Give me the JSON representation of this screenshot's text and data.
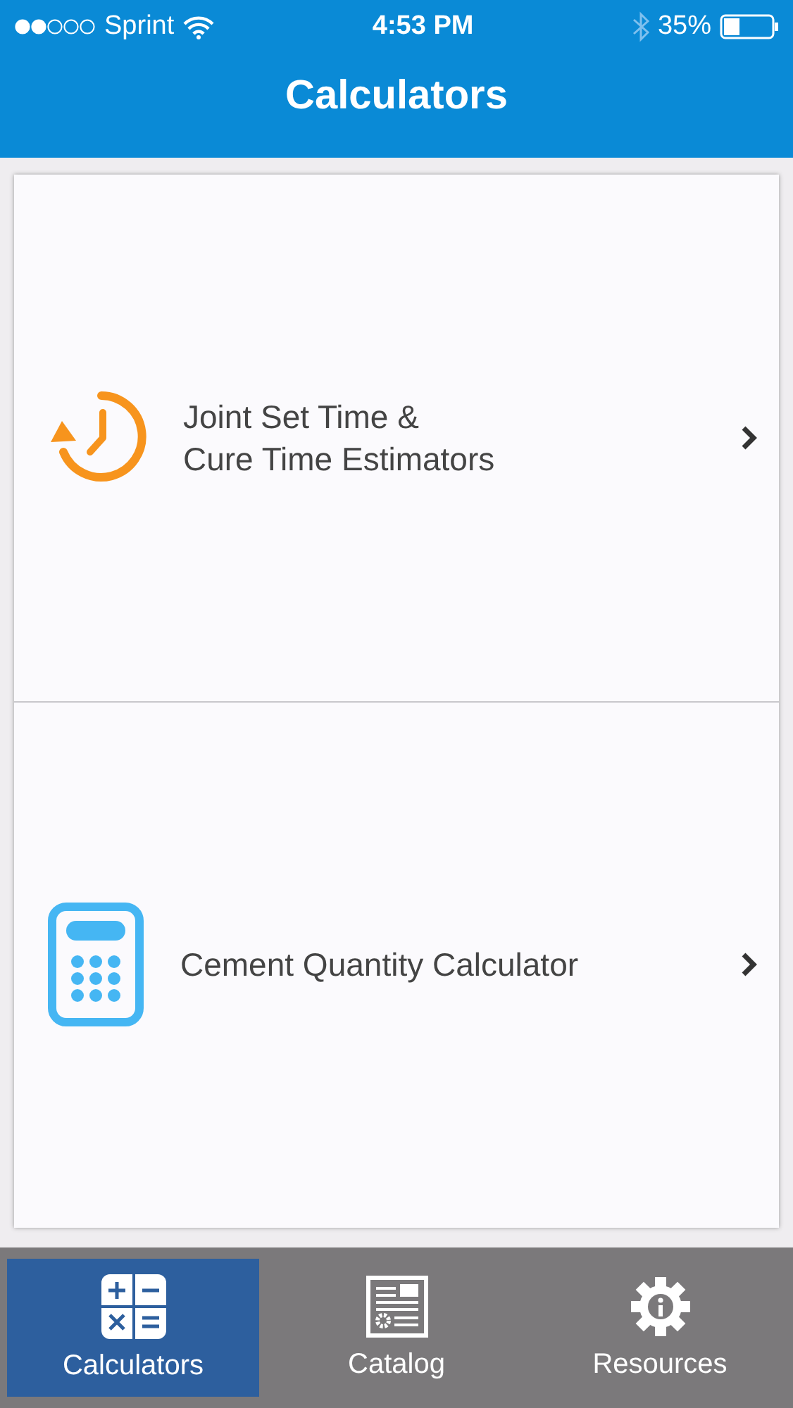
{
  "status_bar": {
    "carrier": "Sprint",
    "time": "4:53 PM",
    "battery": "35%"
  },
  "header": {
    "title": "Calculators"
  },
  "items": [
    {
      "kind": "timer",
      "title_lines": [
        "Joint Set Time &",
        "Cure Time Estimators"
      ]
    },
    {
      "kind": "calculator",
      "title_lines": [
        "Cement Quantity Calculator"
      ]
    }
  ],
  "tabs": [
    {
      "kind": "calculators",
      "label": "Calculators",
      "selected": true
    },
    {
      "kind": "catalog",
      "label": "Catalog",
      "selected": false
    },
    {
      "kind": "resources",
      "label": "Resources",
      "selected": false
    }
  ]
}
